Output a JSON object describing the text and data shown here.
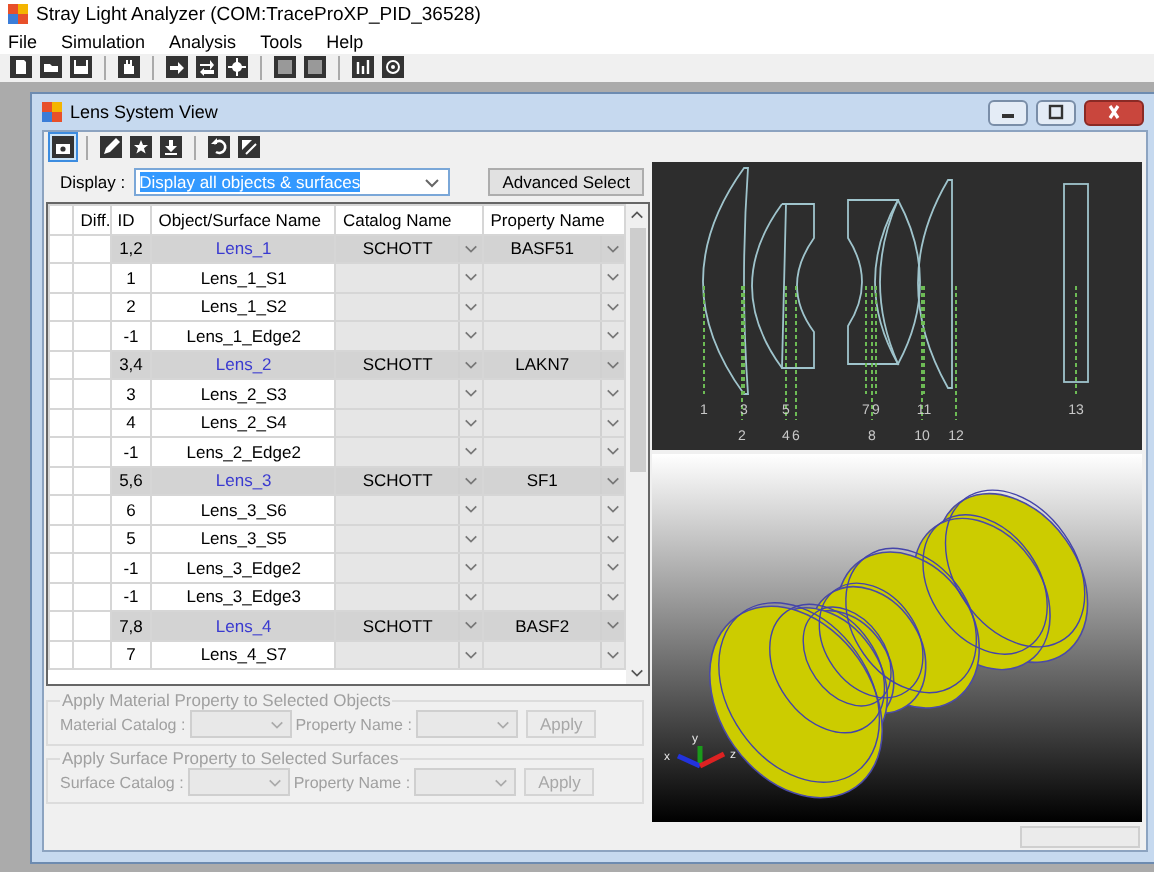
{
  "window": {
    "title": "Stray Light Analyzer (COM:TraceProXP_PID_36528)"
  },
  "menu": [
    "File",
    "Simulation",
    "Analysis",
    "Tools",
    "Help"
  ],
  "child_window": {
    "title": "Lens System View"
  },
  "display": {
    "label": "Display :",
    "value": "Display all objects & surfaces",
    "selected": true
  },
  "advanced_button": "Advanced Select",
  "table": {
    "columns": [
      "Diff.",
      "ID",
      "Object/Surface Name",
      "Catalog Name",
      "Property Name"
    ],
    "rows": [
      {
        "kind": "object",
        "id": "1,2",
        "name": "Lens_1",
        "catalog": "SCHOTT",
        "property": "BASF51"
      },
      {
        "kind": "surface",
        "id": "1",
        "name": "Lens_1_S1"
      },
      {
        "kind": "surface",
        "id": "2",
        "name": "Lens_1_S2"
      },
      {
        "kind": "surface",
        "id": "-1",
        "name": "Lens_1_Edge2"
      },
      {
        "kind": "object",
        "id": "3,4",
        "name": "Lens_2",
        "catalog": "SCHOTT",
        "property": "LAKN7"
      },
      {
        "kind": "surface",
        "id": "3",
        "name": "Lens_2_S3"
      },
      {
        "kind": "surface",
        "id": "4",
        "name": "Lens_2_S4"
      },
      {
        "kind": "surface",
        "id": "-1",
        "name": "Lens_2_Edge2"
      },
      {
        "kind": "object",
        "id": "5,6",
        "name": "Lens_3",
        "catalog": "SCHOTT",
        "property": "SF1"
      },
      {
        "kind": "surface",
        "id": "6",
        "name": "Lens_3_S6"
      },
      {
        "kind": "surface",
        "id": "5",
        "name": "Lens_3_S5"
      },
      {
        "kind": "surface",
        "id": "-1",
        "name": "Lens_3_Edge2"
      },
      {
        "kind": "surface",
        "id": "-1",
        "name": "Lens_3_Edge3"
      },
      {
        "kind": "object",
        "id": "7,8",
        "name": "Lens_4",
        "catalog": "SCHOTT",
        "property": "BASF2"
      },
      {
        "kind": "surface",
        "id": "7",
        "name": "Lens_4_S7"
      }
    ]
  },
  "material_group": {
    "title": "Apply Material Property to Selected Objects",
    "catalog_label": "Material Catalog :",
    "property_label": "Property Name :",
    "button": "Apply",
    "disabled": true
  },
  "surface_group": {
    "title": "Apply Surface Property to Selected Surfaces",
    "catalog_label": "Surface Catalog :",
    "property_label": "Property Name :",
    "button": "Apply",
    "disabled": true
  },
  "view_2d": {
    "surface_labels": [
      "1",
      "2",
      "3",
      "4",
      "5",
      "6",
      "7",
      "8",
      "9",
      "10",
      "11",
      "12",
      "13"
    ]
  },
  "view_3d": {
    "axis_labels": [
      "x",
      "y",
      "z"
    ]
  }
}
